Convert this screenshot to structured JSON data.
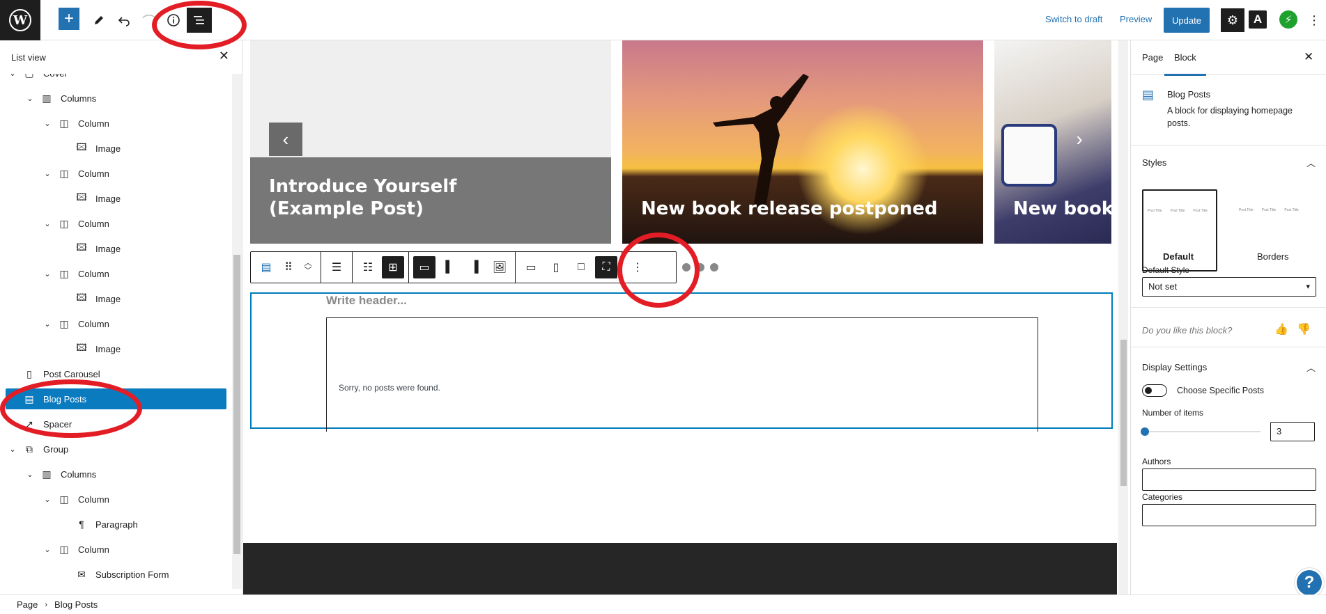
{
  "toolbar": {
    "add_icon": "plus-icon",
    "switch_to_draft": "Switch to draft",
    "preview": "Preview",
    "update": "Update"
  },
  "list_view": {
    "title": "List view",
    "items": [
      {
        "label": "Cover",
        "icon": "cover-icon",
        "depth": 0
      },
      {
        "label": "Columns",
        "icon": "columns-icon",
        "depth": 1
      },
      {
        "label": "Column",
        "icon": "column-icon",
        "depth": 2
      },
      {
        "label": "Image",
        "icon": "image-icon",
        "depth": 3
      },
      {
        "label": "Column",
        "icon": "column-icon",
        "depth": 2
      },
      {
        "label": "Image",
        "icon": "image-icon",
        "depth": 3
      },
      {
        "label": "Column",
        "icon": "column-icon",
        "depth": 2
      },
      {
        "label": "Image",
        "icon": "image-icon",
        "depth": 3
      },
      {
        "label": "Column",
        "icon": "column-icon",
        "depth": 2
      },
      {
        "label": "Image",
        "icon": "image-icon",
        "depth": 3
      },
      {
        "label": "Column",
        "icon": "column-icon",
        "depth": 2
      },
      {
        "label": "Image",
        "icon": "image-icon",
        "depth": 3
      },
      {
        "label": "Post Carousel",
        "icon": "carousel-icon",
        "depth": 0
      },
      {
        "label": "Blog Posts",
        "icon": "blog-posts-icon",
        "depth": 0,
        "selected": true
      },
      {
        "label": "Spacer",
        "icon": "spacer-icon",
        "depth": 0
      },
      {
        "label": "Group",
        "icon": "group-icon",
        "depth": 0
      },
      {
        "label": "Columns",
        "icon": "columns-icon",
        "depth": 1
      },
      {
        "label": "Column",
        "icon": "column-icon",
        "depth": 2
      },
      {
        "label": "Paragraph",
        "icon": "paragraph-icon",
        "depth": 3
      },
      {
        "label": "Column",
        "icon": "column-icon",
        "depth": 2
      },
      {
        "label": "Subscription Form",
        "icon": "envelope-icon",
        "depth": 3
      }
    ]
  },
  "canvas": {
    "slides": [
      {
        "title": "Introduce Yourself (Example Post)"
      },
      {
        "title": "New book release postponed"
      },
      {
        "title": "New book"
      }
    ],
    "blog_header_placeholder": "Write header...",
    "blog_empty_message": "Sorry, no posts were found."
  },
  "settings": {
    "tabs": [
      "Page",
      "Block"
    ],
    "active_tab": "Block",
    "block_name": "Blog Posts",
    "block_desc": "A block for displaying homepage posts.",
    "styles_title": "Styles",
    "style_options": [
      "Default",
      "Borders"
    ],
    "style_preview_text": "Post Title",
    "default_style_label": "Default Style",
    "default_style_value": "Not set",
    "feedback_question": "Do you like this block?",
    "display_settings_title": "Display Settings",
    "choose_specific_posts": "Choose Specific Posts",
    "number_of_items_label": "Number of items",
    "number_of_items_value": "3",
    "authors_label": "Authors",
    "categories_label": "Categories"
  },
  "breadcrumbs": [
    "Page",
    "Blog Posts"
  ],
  "colors": {
    "accent": "#2271b1",
    "selected_row": "#0b7bbf",
    "annotation": "#e31d25",
    "dark": "#1e1e1e"
  }
}
